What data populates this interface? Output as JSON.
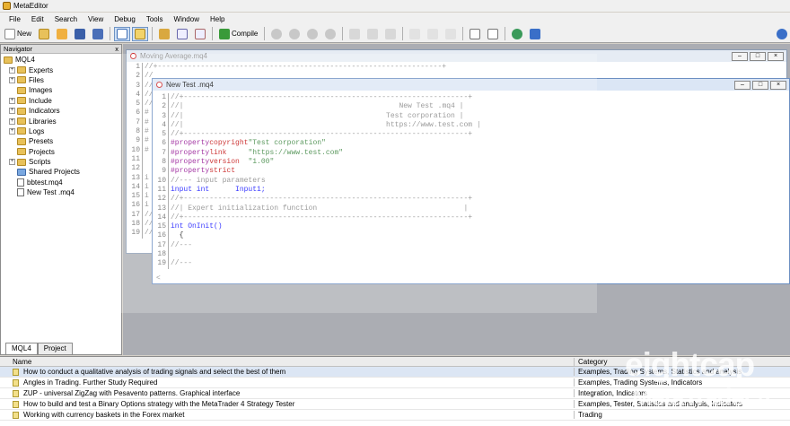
{
  "app": {
    "title": "MetaEditor"
  },
  "menu": [
    "File",
    "Edit",
    "Search",
    "View",
    "Debug",
    "Tools",
    "Window",
    "Help"
  ],
  "toolbar": {
    "new_label": "New",
    "compile_label": "Compile"
  },
  "navigator": {
    "title": "Navigator",
    "close": "x",
    "root": "MQL4",
    "items": [
      {
        "label": "Experts",
        "type": "folder"
      },
      {
        "label": "Files",
        "type": "folder"
      },
      {
        "label": "Images",
        "type": "folder"
      },
      {
        "label": "Include",
        "type": "folder"
      },
      {
        "label": "Indicators",
        "type": "folder"
      },
      {
        "label": "Libraries",
        "type": "folder"
      },
      {
        "label": "Logs",
        "type": "folder"
      },
      {
        "label": "Presets",
        "type": "folder"
      },
      {
        "label": "Projects",
        "type": "folder"
      },
      {
        "label": "Scripts",
        "type": "folder"
      },
      {
        "label": "Shared Projects",
        "type": "shared"
      },
      {
        "label": "bbtest.mq4",
        "type": "file"
      },
      {
        "label": "New Test .mq4",
        "type": "file"
      }
    ],
    "tabs": [
      "MQL4",
      "Project"
    ]
  },
  "back_window": {
    "title": "Moving Average.mq4",
    "lines": [
      {
        "n": "1",
        "t": "//+------------------------------------------------------------------+"
      },
      {
        "n": "2",
        "t": "//"
      },
      {
        "n": "3",
        "t": "//"
      },
      {
        "n": "4",
        "t": "//"
      },
      {
        "n": "5",
        "t": "//"
      },
      {
        "n": "6",
        "t": "#"
      },
      {
        "n": "7",
        "t": "#"
      },
      {
        "n": "8",
        "t": "#"
      },
      {
        "n": "9",
        "t": "#"
      },
      {
        "n": "10",
        "t": "#"
      },
      {
        "n": "11",
        "t": ""
      },
      {
        "n": "12",
        "t": ""
      },
      {
        "n": "13",
        "t": "i"
      },
      {
        "n": "14",
        "t": "i"
      },
      {
        "n": "15",
        "t": "i"
      },
      {
        "n": "16",
        "t": "i"
      },
      {
        "n": "17",
        "t": "//"
      },
      {
        "n": "18",
        "t": "//"
      },
      {
        "n": "19",
        "t": "//"
      }
    ]
  },
  "front_window": {
    "title": "New Test .mq4",
    "lines": [
      {
        "n": "1",
        "t": "//+------------------------------------------------------------------+",
        "c": "cmt"
      },
      {
        "n": "2",
        "t": "//|                                                  New Test .mq4 |",
        "c": "cmt"
      },
      {
        "n": "3",
        "t": "//|                                               Test corporation |",
        "c": "cmt"
      },
      {
        "n": "4",
        "t": "//|                                               https://www.test.com |",
        "c": "cmt"
      },
      {
        "n": "5",
        "t": "//+------------------------------------------------------------------+",
        "c": "cmt"
      },
      {
        "n": "6",
        "pp": "#property",
        "kw": "copyright",
        "val": "\"Test corporation\""
      },
      {
        "n": "7",
        "pp": "#property",
        "kw": "link     ",
        "val": "\"https://www.test.com\""
      },
      {
        "n": "8",
        "pp": "#property",
        "kw": "version  ",
        "val": "\"1.00\""
      },
      {
        "n": "9",
        "pp": "#property",
        "kw": "strict",
        "val": ""
      },
      {
        "n": "10",
        "t": "//--- input parameters",
        "c": "cmt"
      },
      {
        "n": "11",
        "t": "input int      Input1;",
        "c": "decl"
      },
      {
        "n": "12",
        "t": "//+------------------------------------------------------------------+",
        "c": "cmt"
      },
      {
        "n": "13",
        "t": "//| Expert initialization function                                  |",
        "c": "cmt"
      },
      {
        "n": "14",
        "t": "//+------------------------------------------------------------------+",
        "c": "cmt"
      },
      {
        "n": "15",
        "t": "int OnInit()",
        "c": "fn"
      },
      {
        "n": "16",
        "t": "  {",
        "c": "plain"
      },
      {
        "n": "17",
        "t": "//---",
        "c": "cmt"
      },
      {
        "n": "18",
        "t": "",
        "c": "plain"
      },
      {
        "n": "19",
        "t": "//---",
        "c": "cmt"
      }
    ]
  },
  "toolbox": {
    "col_name": "Name",
    "col_category": "Category",
    "rows": [
      {
        "name": "How to conduct a qualitative analysis of trading signals and select the best of them",
        "category": "Examples, Trading Systems, Statistics and analysis"
      },
      {
        "name": "Angles in Trading. Further Study Required",
        "category": "Examples, Trading Systems, Indicators"
      },
      {
        "name": "ZUP - universal ZigZag with Pesavento patterns. Graphical interface",
        "category": "Integration, Indicators"
      },
      {
        "name": "How to build and test a Binary Options strategy with the MetaTrader 4 Strategy Tester",
        "category": "Examples, Tester, Statistics and analysis, Indicators"
      },
      {
        "name": "Working with currency baskets in the Forex market",
        "category": "Trading"
      }
    ]
  },
  "watermark": {
    "brand": "eightcap",
    "product": "MetaTrader 4"
  }
}
